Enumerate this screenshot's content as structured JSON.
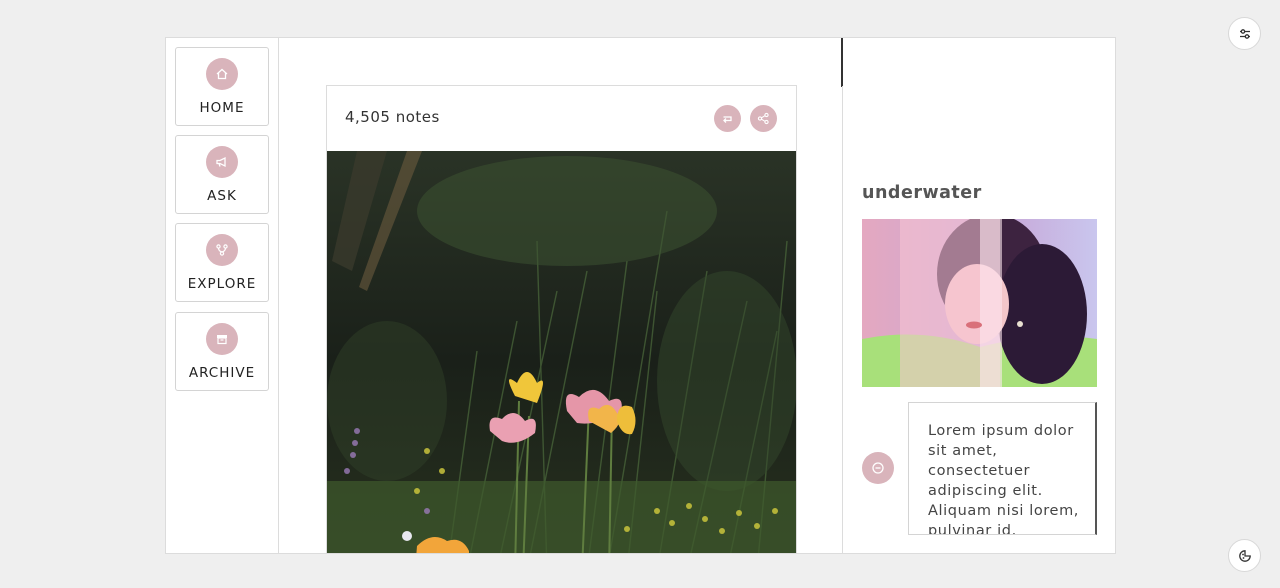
{
  "nav": {
    "items": [
      {
        "label": "HOME",
        "icon": "home-icon"
      },
      {
        "label": "ASK",
        "icon": "megaphone-icon"
      },
      {
        "label": "EXPLORE",
        "icon": "branch-icon"
      },
      {
        "label": "ARCHIVE",
        "icon": "archive-icon"
      }
    ]
  },
  "post": {
    "notes": "4,505 notes",
    "reblog_icon": "reblog-icon",
    "share_icon": "share-icon",
    "image_icon": "tulip-garden-photo"
  },
  "sidebar": {
    "title": "underwater",
    "avatar_icon": "avatar-photo",
    "circle_icon": "minus-circle-icon",
    "description": "Lorem ipsum dolor sit amet, consectetuer adipiscing elit. Aliquam nisi lorem, pulvinar id,"
  },
  "corners": {
    "settings_icon": "sliders-icon",
    "theme_icon": "palette-icon"
  },
  "colors": {
    "accent": "#d9b4bb",
    "background": "#efefef",
    "panel": "#ffffff",
    "border": "#dcdcdc"
  }
}
